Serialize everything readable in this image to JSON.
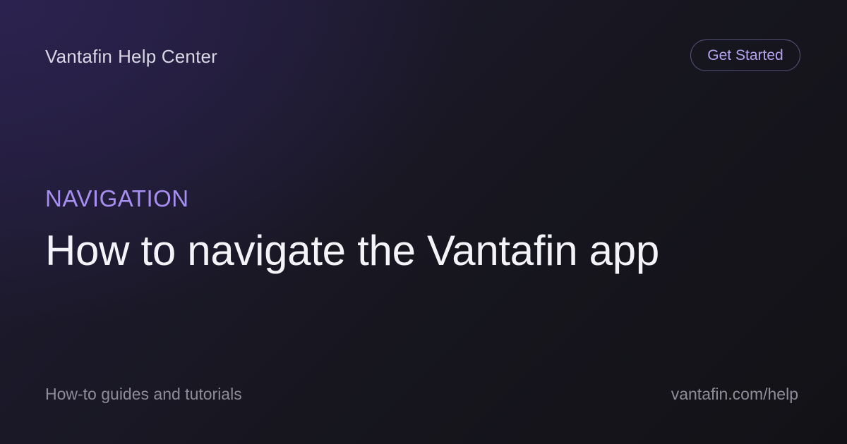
{
  "header": {
    "brand_name": "Vantafin",
    "brand_suffix": "Help Center",
    "cta_label": "Get Started"
  },
  "article": {
    "category": "NAVIGATION",
    "title": "How to navigate the Vantafin app"
  },
  "footer": {
    "tagline": "How-to guides and tutorials",
    "url": "vantafin.com/help"
  },
  "colors": {
    "background": "#17161f",
    "accent": "#a68ff0",
    "muted_text": "#8e8c99"
  }
}
